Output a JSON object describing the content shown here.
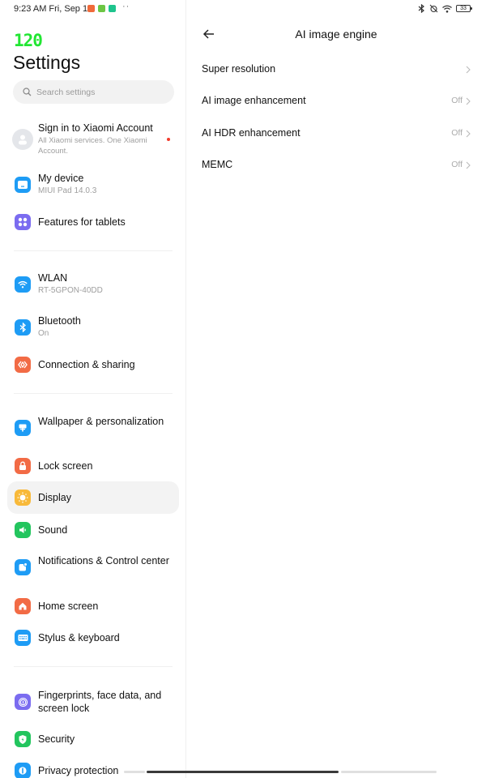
{
  "status_bar": {
    "time": "9:23 AM Fri, Sep 1",
    "notification_icons": [
      {
        "name": "mi-app-icon",
        "color": "#f06a3a"
      },
      {
        "name": "download-app-icon",
        "color": "#6cc644"
      },
      {
        "name": "security-app-icon",
        "color": "#1ec48d"
      }
    ],
    "more_indicator": "··",
    "battery_level": "33"
  },
  "sidebar": {
    "fps_overlay": "120",
    "title": "Settings",
    "search_placeholder": "Search settings",
    "account": {
      "label": "Sign in to Xiaomi Account",
      "sublabel": "All Xiaomi services. One Xiaomi Account."
    },
    "items": [
      {
        "id": "my-device",
        "label": "My device",
        "sublabel": "MIUI Pad 14.0.3",
        "icon": "tablet-icon",
        "color": "#1e9cf5"
      },
      {
        "id": "features-for-tablets",
        "label": "Features for tablets",
        "icon": "grid-icon",
        "color": "#7b6cf0"
      },
      {
        "id": "wlan",
        "label": "WLAN",
        "sublabel": "RT-5GPON-40DD",
        "icon": "wifi-icon",
        "color": "#1e9cf5"
      },
      {
        "id": "bluetooth",
        "label": "Bluetooth",
        "sublabel": "On",
        "icon": "bluetooth-icon",
        "color": "#1e9cf5"
      },
      {
        "id": "connection-sharing",
        "label": "Connection & sharing",
        "icon": "connection-icon",
        "color": "#f26b45"
      },
      {
        "id": "wallpaper",
        "label": "Wallpaper & personalization",
        "icon": "wallpaper-icon",
        "color": "#1e9cf5"
      },
      {
        "id": "lock-screen",
        "label": "Lock screen",
        "icon": "lock-icon",
        "color": "#f26b45"
      },
      {
        "id": "display",
        "label": "Display",
        "icon": "sun-icon",
        "color": "#f8b93a",
        "active": true
      },
      {
        "id": "sound",
        "label": "Sound",
        "icon": "speaker-icon",
        "color": "#23c55e"
      },
      {
        "id": "notifications",
        "label": "Notifications & Control center",
        "icon": "notification-icon",
        "color": "#1e9cf5"
      },
      {
        "id": "home-screen",
        "label": "Home screen",
        "icon": "home-icon",
        "color": "#f26b45"
      },
      {
        "id": "stylus-keyboard",
        "label": "Stylus & keyboard",
        "icon": "keyboard-icon",
        "color": "#1e9cf5"
      },
      {
        "id": "fingerprints",
        "label": "Fingerprints, face data, and screen lock",
        "icon": "fingerprint-icon",
        "color": "#7b6cf0"
      },
      {
        "id": "security",
        "label": "Security",
        "icon": "shield-icon",
        "color": "#23c55e"
      },
      {
        "id": "privacy",
        "label": "Privacy protection",
        "icon": "privacy-icon",
        "color": "#1e9cf5"
      }
    ]
  },
  "detail": {
    "title": "AI image engine",
    "rows": [
      {
        "label": "Super resolution",
        "value": ""
      },
      {
        "label": "AI image enhancement",
        "value": "Off"
      },
      {
        "label": "AI HDR enhancement",
        "value": "Off"
      },
      {
        "label": "MEMC",
        "value": "Off"
      }
    ]
  }
}
